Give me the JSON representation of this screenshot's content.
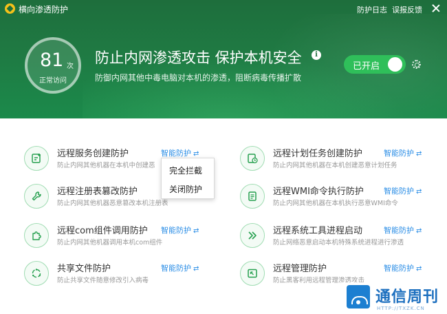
{
  "app": {
    "title": "横向渗透防护"
  },
  "titlebar": {
    "log": "防护日志",
    "feedback": "误报反馈"
  },
  "stats": {
    "count": "81",
    "unit": "次",
    "label": "正常访问"
  },
  "hero": {
    "title": "防止内网渗透攻击 保护本机安全",
    "subtitle": "防御内网其他中毒电脑对本机的渗透，阻断病毒传播扩散"
  },
  "toggle": {
    "label": "已开启"
  },
  "items": [
    {
      "title": "远程服务创建防护",
      "desc": "防止内网其他机器在本机中创建恶",
      "mode": "智能防护",
      "icon": "service-create-icon"
    },
    {
      "title": "远程计划任务创建防护",
      "desc": "防止内网其他机器在本机创建恶意计划任务",
      "mode": "智能防护",
      "icon": "scheduled-task-icon"
    },
    {
      "title": "远程注册表篡改防护",
      "desc": "防止内网其他机器恶意篡改本机注册表",
      "mode": "智能防护",
      "icon": "wrench-icon"
    },
    {
      "title": "远程WMI命令执行防护",
      "desc": "防止内网其他机器在本机执行恶意WMI命令",
      "mode": "智能防护",
      "icon": "document-icon"
    },
    {
      "title": "远程com组件调用防护",
      "desc": "防止内网其他机器调用本机com组件",
      "mode": "智能防护",
      "icon": "puzzle-icon"
    },
    {
      "title": "远程系统工具进程启动",
      "desc": "防止网络恶意启动本机特殊系统进程进行渗透",
      "mode": "智能防护",
      "icon": "double-chevron-icon"
    },
    {
      "title": "共享文件防护",
      "desc": "防止共享文件随意修改引入病毒",
      "mode": "智能防护",
      "icon": "share-circle-icon"
    },
    {
      "title": "远程管理防护",
      "desc": "防止黑客利用远程管理渗透攻击",
      "mode": "智能防护",
      "icon": "remote-screen-icon"
    }
  ],
  "dropdown": {
    "options": [
      "完全拦截",
      "关闭防护"
    ]
  },
  "watermark": {
    "name": "通信周刊",
    "url": "HTTP://TXZK.CN"
  },
  "colors": {
    "header": "#1e6e3c",
    "accent": "#2fbf5a",
    "link": "#2b8ee6"
  }
}
